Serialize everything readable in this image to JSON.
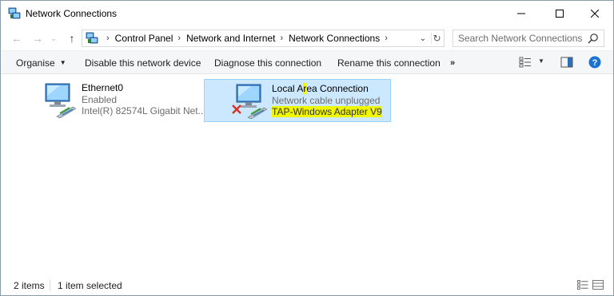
{
  "window": {
    "title": "Network Connections",
    "minimize_glyph": "—",
    "maximize_glyph": "☐",
    "close_glyph": "✕"
  },
  "nav": {
    "back_glyph": "←",
    "forward_glyph": "→",
    "recent_glyph": "⌄",
    "up_glyph": "↑"
  },
  "address": {
    "breadcrumbs": [
      "Control Panel",
      "Network and Internet",
      "Network Connections"
    ],
    "separator": "›",
    "dropdown_glyph": "⌄",
    "refresh_glyph": "↻"
  },
  "search": {
    "placeholder": "Search Network Connections",
    "value": ""
  },
  "toolbar": {
    "organise_label": "Organise",
    "organise_caret": "▼",
    "disable_label": "Disable this network device",
    "diagnose_label": "Diagnose this connection",
    "rename_label": "Rename this connection",
    "more_label": "»",
    "view_caret": "▼",
    "help_glyph": "?"
  },
  "connections": [
    {
      "name": "Ethernet0",
      "status": "Enabled",
      "device": "Intel(R) 82574L Gigabit Net...",
      "selected": false,
      "icon": "network-adapter-icon"
    },
    {
      "name_part1": "Local A",
      "name_part2": "r",
      "name_part3": "ea Connection",
      "status": "Network cable unplugged",
      "device": "TAP-Windows Adapter V9",
      "selected": true,
      "icon": "network-adapter-disconnected-icon"
    }
  ],
  "statusbar": {
    "item_count": "2 items",
    "selection": "1 item selected"
  },
  "colors": {
    "selection_bg": "#cce8ff",
    "selection_border": "#99d1ff",
    "highlight": "#f0f500",
    "help_blue": "#1a73d1",
    "error_red": "#d93025"
  }
}
